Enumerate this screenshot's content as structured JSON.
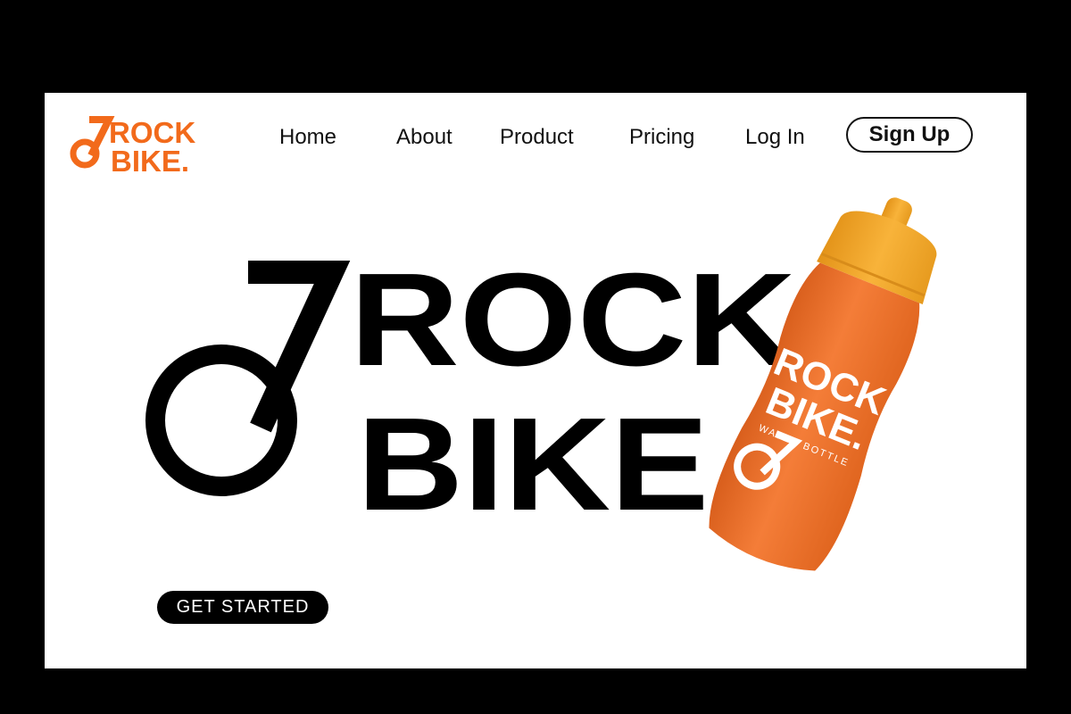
{
  "brand": {
    "logo_line1": "ROCK",
    "logo_line2": "BIKE.",
    "accent_color": "#F26A1B",
    "ink_color": "#000000"
  },
  "nav": {
    "links": [
      {
        "label": "Home"
      },
      {
        "label": "About"
      },
      {
        "label": "Product"
      },
      {
        "label": "Pricing"
      },
      {
        "label": "Log In"
      }
    ],
    "signup_label": "Sign Up"
  },
  "hero": {
    "title_line1": "ROCK",
    "title_line2": "BIKE.",
    "cta_label": "GET STARTED"
  },
  "product": {
    "bottle_body_color": "#F07A35",
    "bottle_cap_color": "#F5A623",
    "print_line1": "ROCK",
    "print_line2": "BIKE.",
    "print_caption": "WATER BOTTLE"
  }
}
